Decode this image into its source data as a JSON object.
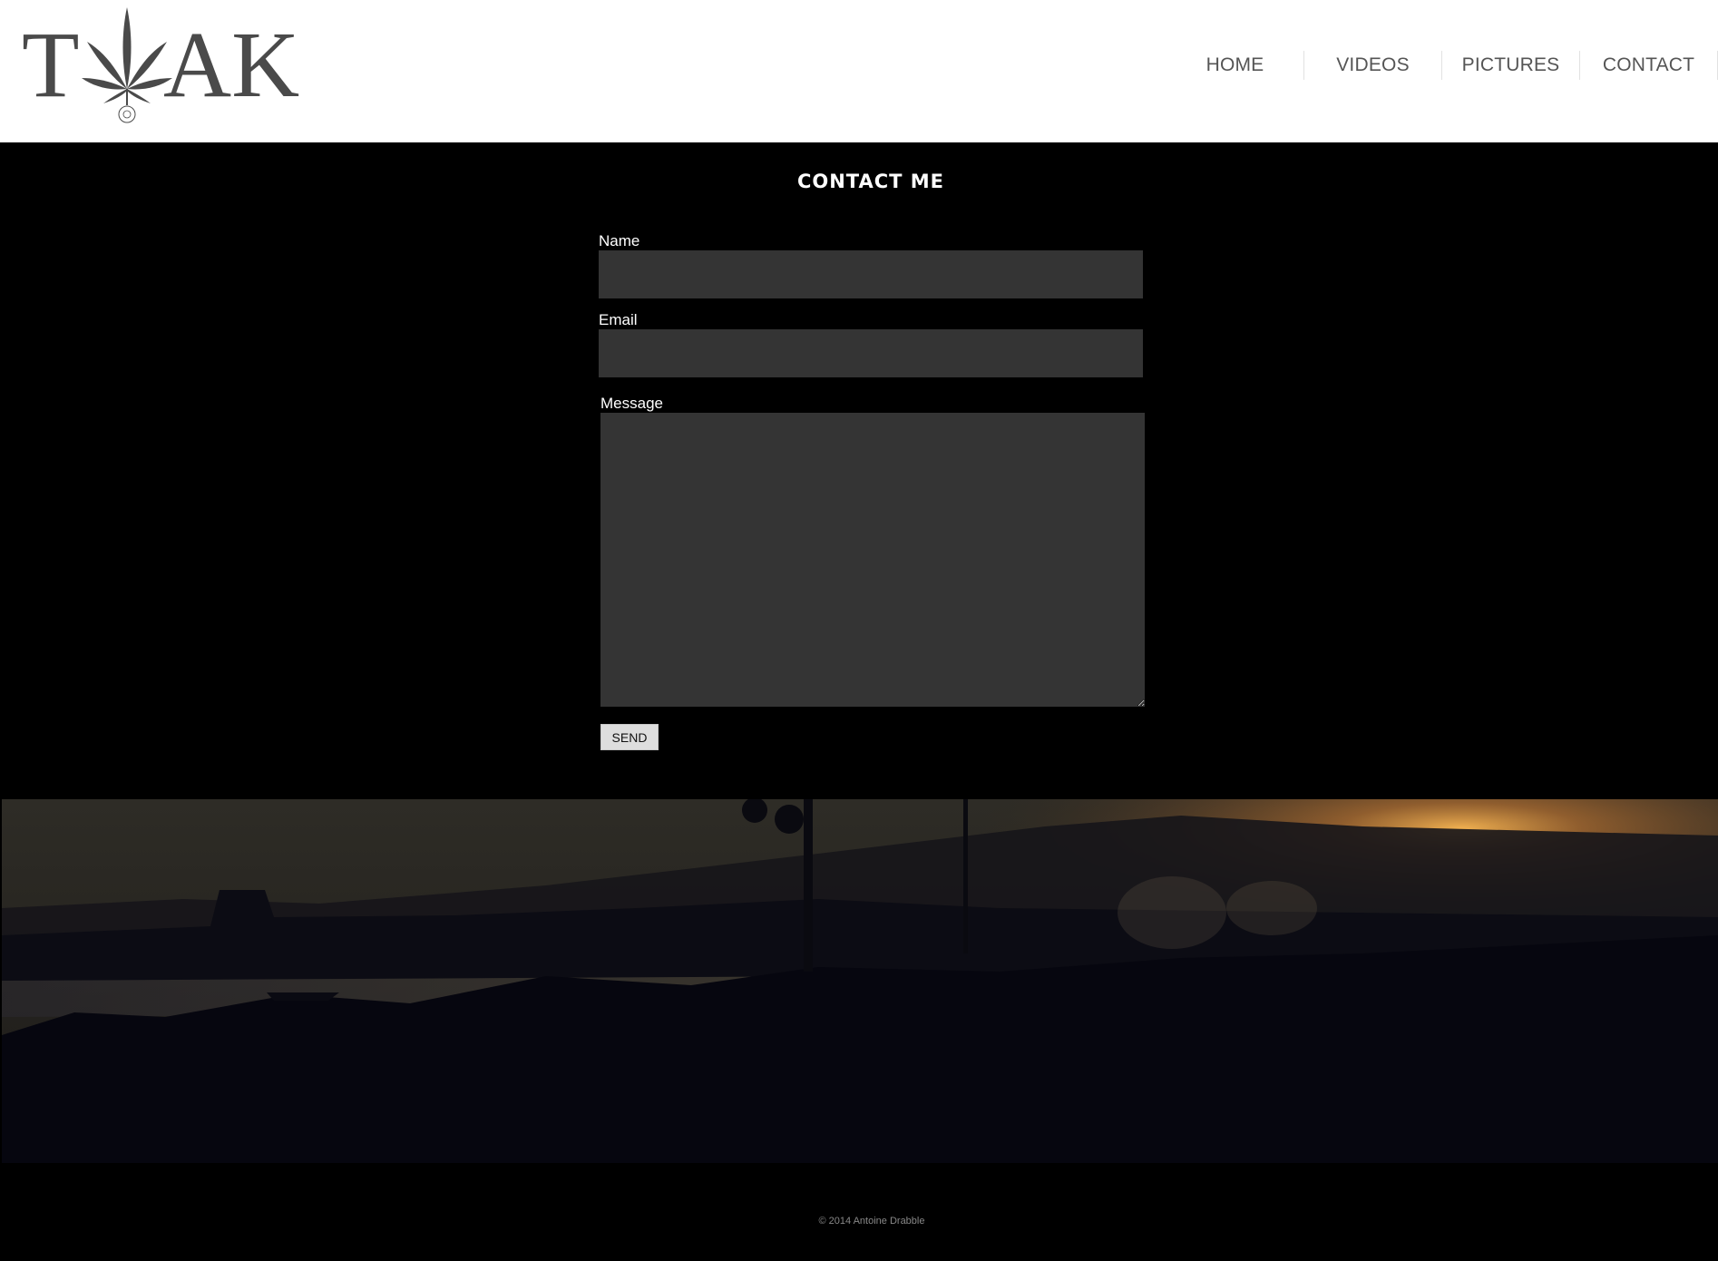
{
  "header": {
    "logo": {
      "text_left": "T",
      "text_right": "AK",
      "icon": "cannabis-leaf-icon",
      "color": "#4a4a4a"
    },
    "nav": [
      {
        "label": "HOME"
      },
      {
        "label": "VIDEOS"
      },
      {
        "label": "PICTURES"
      },
      {
        "label": "CONTACT"
      }
    ]
  },
  "main": {
    "title": "CONTACT ME",
    "form": {
      "name_label": "Name",
      "name_value": "",
      "email_label": "Email",
      "email_value": "",
      "message_label": "Message",
      "message_value": "",
      "send_label": "SEND"
    }
  },
  "banner": {
    "icon": "sunset-lake-photo",
    "colors": {
      "sky": "#2f2a24",
      "sun": "#e8a040",
      "ground": "#05050f"
    }
  },
  "footer": {
    "copyright": "© 2014 Antoine Drabble"
  },
  "theme": {
    "background": "#000000",
    "field_bg": "#343434",
    "header_bg": "#ffffff",
    "nav_text": "#555555"
  }
}
